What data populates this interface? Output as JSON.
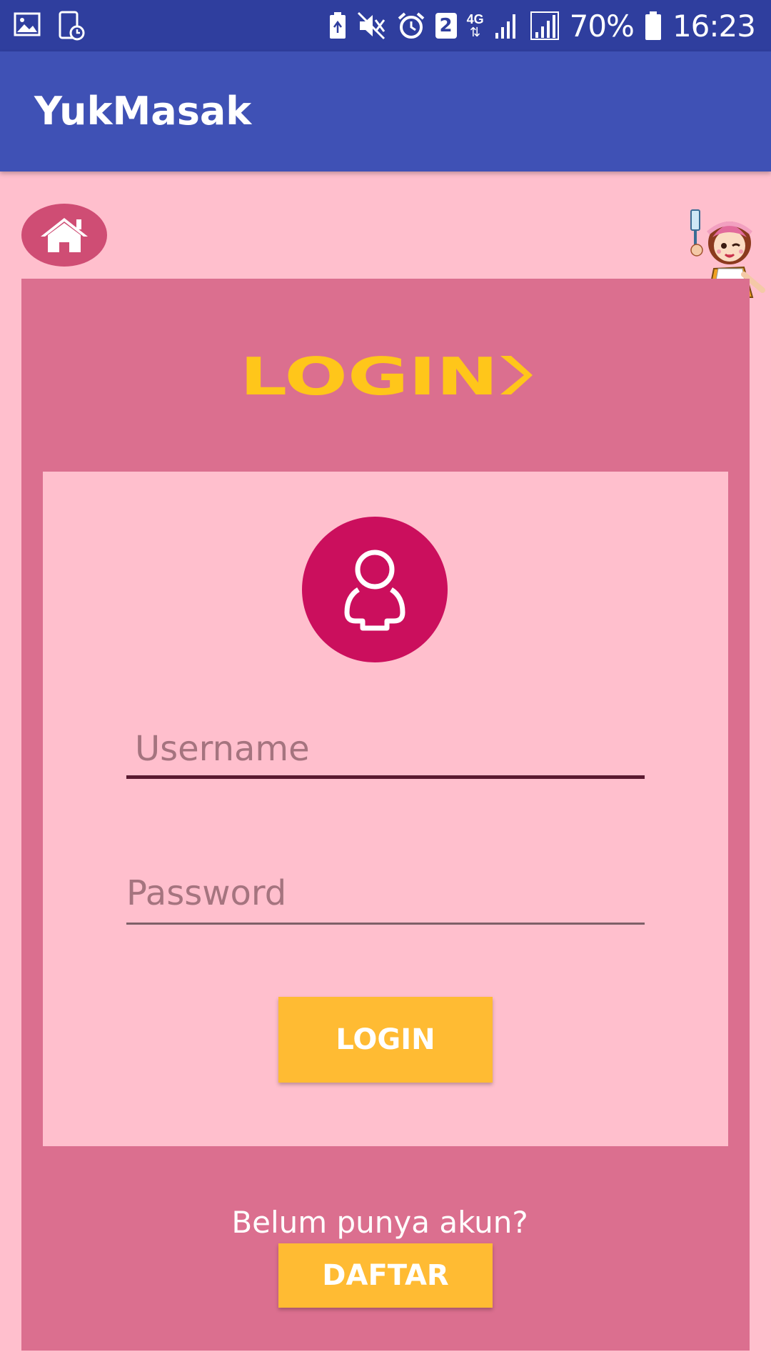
{
  "status_bar": {
    "battery": "70%",
    "time": "16:23",
    "sim_badge": "2",
    "network": "4G",
    "icons": [
      "gallery-icon",
      "screenshot-icon",
      "battery-saver-icon",
      "mute-icon",
      "alarm-icon",
      "sim-icon",
      "network-4g-icon",
      "signal-icon",
      "signal-icon",
      "battery-icon"
    ]
  },
  "app_bar": {
    "title": "YukMasak"
  },
  "login": {
    "logo_text": "LOGIN",
    "username_placeholder": "Username",
    "password_placeholder": "Password",
    "login_button": "LOGIN",
    "no_account_text": "Belum punya akun?",
    "register_button": "DAFTAR"
  },
  "colors": {
    "status_bar": "#2f3e9e",
    "app_bar": "#3f51b5",
    "background": "#ffbfcd",
    "panel": "#db6f8f",
    "avatar": "#cb0f5d",
    "button": "#ffbb33",
    "logo": "#ffc61a"
  }
}
